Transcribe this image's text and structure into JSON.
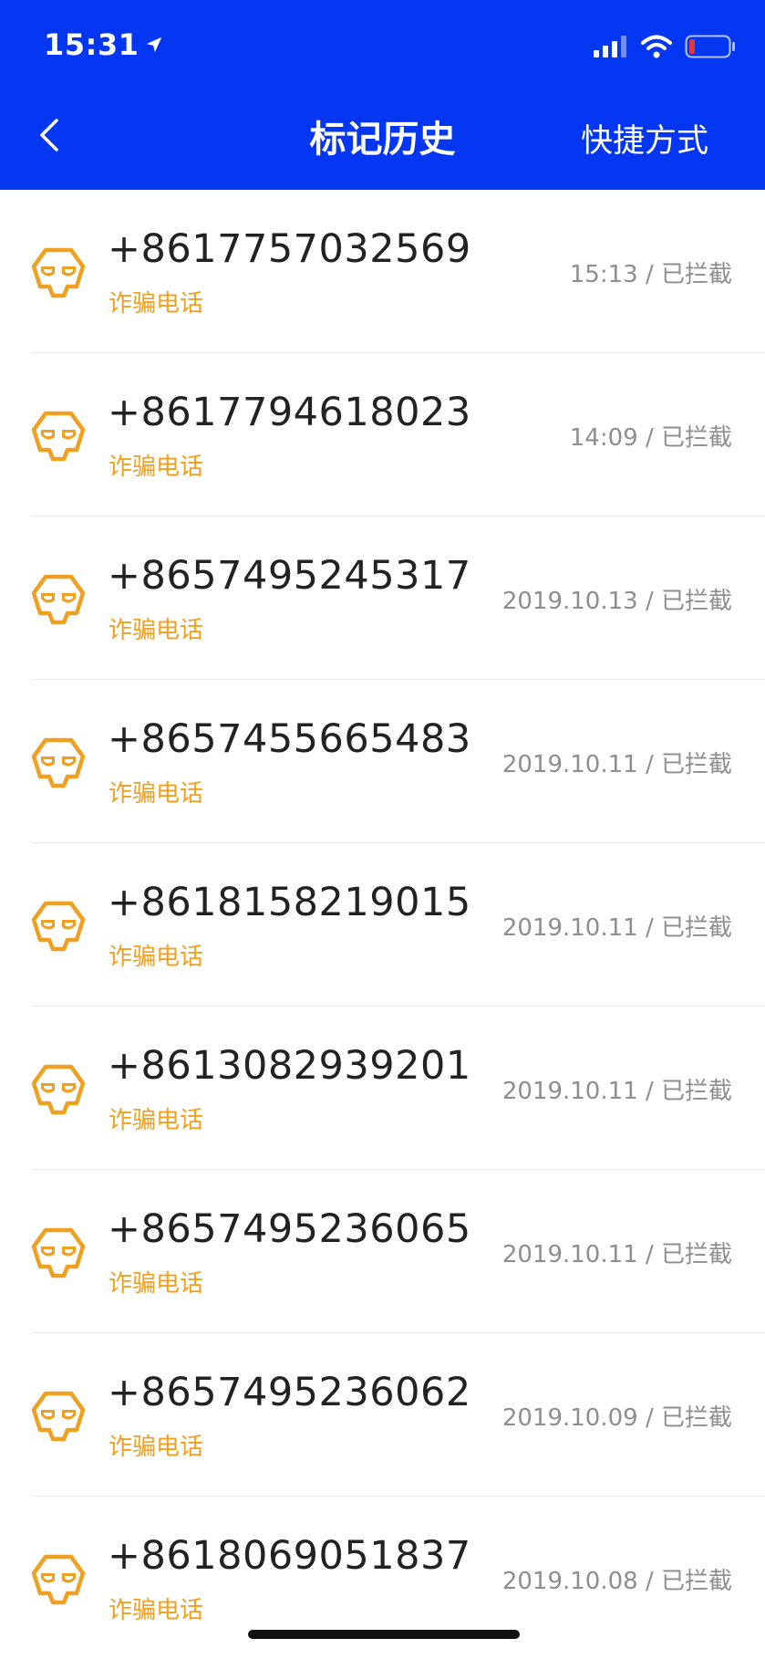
{
  "status_bar": {
    "time": "15:31"
  },
  "nav": {
    "title": "标记历史",
    "right_action": "快捷方式",
    "back_icon": "chevron-left-icon"
  },
  "colors": {
    "header_bg": "#0336F0",
    "tag": "#F0A020",
    "meta": "#8e8e8e",
    "phone": "#222222",
    "battery_low": "#E53935"
  },
  "records": [
    {
      "phone": "+8617757032569",
      "tag": "诈骗电话",
      "time": "15:13",
      "status": "已拦截",
      "icon": "fraud-mask-icon"
    },
    {
      "phone": "+8617794618023",
      "tag": "诈骗电话",
      "time": "14:09",
      "status": "已拦截",
      "icon": "fraud-mask-icon"
    },
    {
      "phone": "+8657495245317",
      "tag": "诈骗电话",
      "time": "2019.10.13",
      "status": "已拦截",
      "icon": "fraud-mask-icon"
    },
    {
      "phone": "+8657455665483",
      "tag": "诈骗电话",
      "time": "2019.10.11",
      "status": "已拦截",
      "icon": "fraud-mask-icon"
    },
    {
      "phone": "+8618158219015",
      "tag": "诈骗电话",
      "time": "2019.10.11",
      "status": "已拦截",
      "icon": "fraud-mask-icon"
    },
    {
      "phone": "+8613082939201",
      "tag": "诈骗电话",
      "time": "2019.10.11",
      "status": "已拦截",
      "icon": "fraud-mask-icon"
    },
    {
      "phone": "+8657495236065",
      "tag": "诈骗电话",
      "time": "2019.10.11",
      "status": "已拦截",
      "icon": "fraud-mask-icon"
    },
    {
      "phone": "+8657495236062",
      "tag": "诈骗电话",
      "time": "2019.10.09",
      "status": "已拦截",
      "icon": "fraud-mask-icon"
    },
    {
      "phone": "+8618069051837",
      "tag": "诈骗电话",
      "time": "2019.10.08",
      "status": "已拦截",
      "icon": "fraud-mask-icon"
    }
  ]
}
